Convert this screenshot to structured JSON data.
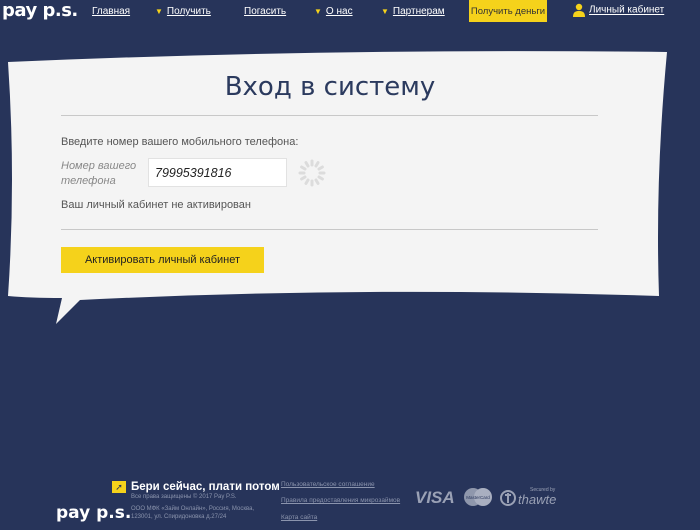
{
  "header": {
    "logo": "pay p.s.",
    "nav": [
      {
        "label": "Главная",
        "arrow": false
      },
      {
        "label": "Получить",
        "arrow": true
      },
      {
        "label": "Погасить",
        "arrow": false
      },
      {
        "label": "О нас",
        "arrow": true
      },
      {
        "label": "Партнерам",
        "arrow": true
      }
    ],
    "cta": "Получить деньги",
    "cabinet": "Личный кабинет"
  },
  "login": {
    "title": "Вход в систему",
    "prompt": "Введите номер вашего мобильного телефона:",
    "field_label": "Номер вашего телефона",
    "phone_value": "79995391816",
    "status": "Ваш личный кабинет не активирован",
    "activate_button": "Активировать личный кабинет"
  },
  "footer": {
    "slogan": "Бери сейчас, плати потом",
    "logo": "pay p.s.",
    "legal": [
      "Все права защищены © 2017 Pay P.S.",
      "ООО МФК «Займ Онлайн», Россия, Москва,",
      "123001, ул. Спиридоновка д.27/24"
    ],
    "links": [
      "Пользовательское соглашение",
      "Правила предоставления микрозаймов",
      "Карта сайта"
    ],
    "badges": {
      "visa": "VISA",
      "mastercard": "MasterCard",
      "thawte_secured": "Secured by",
      "thawte": "thawte"
    }
  },
  "colors": {
    "background": "#27345a",
    "accent": "#f5d21b",
    "card": "#f4f4f4",
    "title": "#2b3a5e"
  },
  "icons": [
    "user-icon",
    "arrow-icon",
    "spinner-icon",
    "visa-logo",
    "mastercard-logo",
    "thawte-logo"
  ]
}
